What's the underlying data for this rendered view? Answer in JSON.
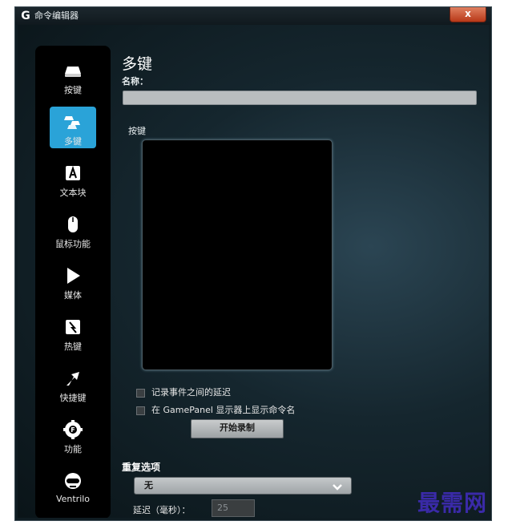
{
  "window": {
    "title": "命令编辑器",
    "logo": "G",
    "close_label": "x"
  },
  "sidebar": {
    "items": [
      {
        "label": "按键",
        "icon": "keycap-icon",
        "active": false
      },
      {
        "label": "多键",
        "icon": "multi-key-icon",
        "active": true
      },
      {
        "label": "文本块",
        "icon": "text-block-icon",
        "active": false
      },
      {
        "label": "鼠标功能",
        "icon": "mouse-icon",
        "active": false
      },
      {
        "label": "媒体",
        "icon": "play-icon",
        "active": false
      },
      {
        "label": "热键",
        "icon": "hotkey-icon",
        "active": false
      },
      {
        "label": "快捷键",
        "icon": "shortcut-arrow-icon",
        "active": false
      },
      {
        "label": "功能",
        "icon": "function-icon",
        "active": false
      },
      {
        "label": "Ventrilo",
        "icon": "headset-icon",
        "active": false
      }
    ]
  },
  "main": {
    "title": "多键",
    "name_label": "名称：",
    "name_value": "",
    "keys_label": "按键",
    "options": [
      {
        "label": "记录事件之间的延迟",
        "checked": false
      },
      {
        "label": "在 GamePanel 显示器上显示命令名",
        "checked": false
      }
    ],
    "record_button": "开始录制",
    "repeat_label": "重复选项",
    "repeat_value": "无",
    "delay_label": "延迟（毫秒）：",
    "delay_value": "25"
  },
  "watermark": "最需网",
  "colors": {
    "accent": "#2aa3d8",
    "close": "#c8461e",
    "watermark": "#3a2aa8"
  }
}
